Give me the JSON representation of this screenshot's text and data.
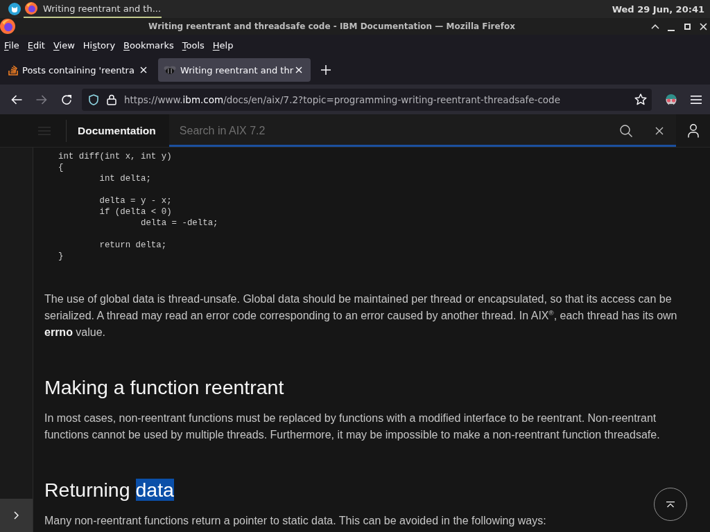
{
  "panel": {
    "task": {
      "label": "Writing reentrant and th...",
      "active": true
    },
    "clock": "Wed 29 Jun, 20:41"
  },
  "window": {
    "title": "Writing reentrant and threadsafe code - IBM Documentation — Mozilla Firefox"
  },
  "menu_bar": [
    {
      "key": "F",
      "after": "ile"
    },
    {
      "key": "E",
      "after": "dit"
    },
    {
      "key": "V",
      "after": "iew"
    },
    {
      "before": "Hi",
      "key": "s",
      "after": "tory"
    },
    {
      "key": "B",
      "after": "ookmarks"
    },
    {
      "key": "T",
      "after": "ools"
    },
    {
      "key": "H",
      "after": "elp"
    }
  ],
  "tabs": [
    {
      "kind": "forum",
      "label": "Posts containing 'reentra",
      "selected": false
    },
    {
      "kind": "docs",
      "label": "Writing reentrant and thr",
      "selected": true
    }
  ],
  "nav_buttons": [
    {
      "kind": "back",
      "disabled": false
    },
    {
      "kind": "forward",
      "disabled": true
    },
    {
      "kind": "reload",
      "disabled": false
    }
  ],
  "address_bar": {
    "scheme": "https://www.",
    "domain": "ibm.com",
    "path": "/docs/en/aix/7.2?topic=programming-writing-reentrant-threadsafe-code"
  },
  "doc_header": {
    "title": "Documentation",
    "search": {
      "placeholder": "Search in AIX 7.2",
      "focused": true
    }
  },
  "sidebar": {
    "expanded": false
  },
  "article": {
    "code": "int diff(int x, int y)\n{\n\tint delta;\n\n\tdelta = y - x;\n\tif (delta < 0)\n\t\tdelta = -delta;\n\n\treturn delta;\n}",
    "blocks": [
      {
        "kind": "paragraph",
        "text": "The use of global data is thread-unsafe. Global data should be maintained per thread or encapsulated, so that its access can be serialized. A thread may read an error code corresponding to an error caused by another thread. In AIX$^{®}$, each thread has its own **errno** value."
      },
      {
        "kind": "heading",
        "segments": [
          {
            "text": "Making a function reentrant",
            "selected": false
          }
        ]
      },
      {
        "kind": "paragraph",
        "text": "In most cases, non-reentrant functions must be replaced by functions with a modified interface to be reentrant. Non-reentrant functions cannot be used by multiple threads. Furthermore, it may be impossible to make a non-reentrant function threadsafe."
      },
      {
        "kind": "heading",
        "segments": [
          {
            "text": "Returning",
            "selected": false
          },
          {
            "text": "data",
            "selected": true
          }
        ]
      },
      {
        "kind": "paragraph",
        "text": "Many non-reentrant functions return a pointer to static data. This can be avoided in the following ways:"
      }
    ]
  }
}
